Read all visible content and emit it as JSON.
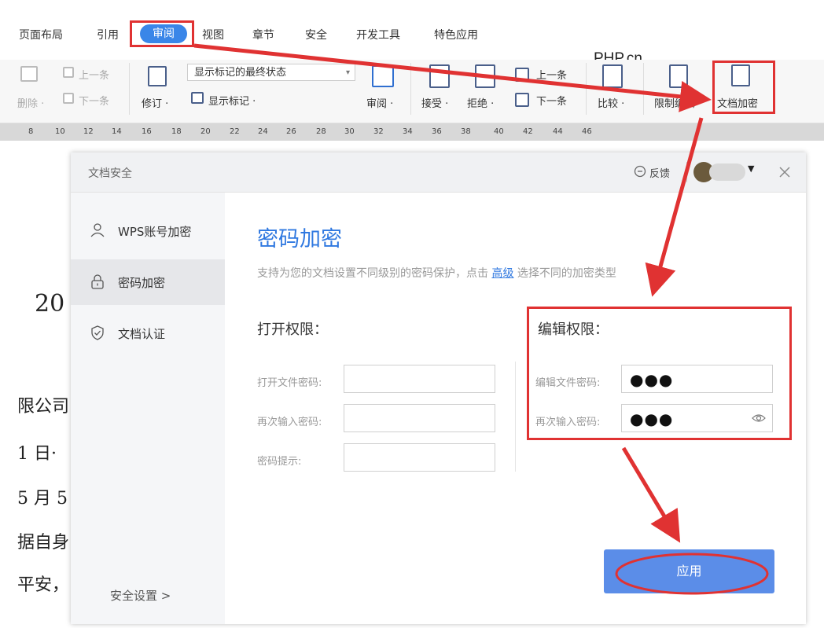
{
  "menu": {
    "items": [
      "页面布局",
      "引用",
      "审阅",
      "视图",
      "章节",
      "安全",
      "开发工具",
      "特色应用"
    ],
    "active_index": 2
  },
  "watermark": "PHP.cn",
  "ribbon": {
    "prev_label": "上一条",
    "next_label": "下一条",
    "delete_label": "删除 ·",
    "revise_label": "修订 ·",
    "markup_state_value": "显示标记的最终状态",
    "show_markup_label": "显示标记 ·",
    "review_label": "审阅 ·",
    "accept_label": "接受 ·",
    "reject_label": "拒绝 ·",
    "prev2_label": "上一条",
    "next2_label": "下一条",
    "compare_label": "比较 ·",
    "restrict_label": "限制编辑",
    "encrypt_label": "文档加密"
  },
  "ruler": [
    "8",
    "10",
    "12",
    "14",
    "16",
    "18",
    "20",
    "22",
    "24",
    "26",
    "28",
    "30",
    "32",
    "34",
    "36",
    "38",
    "40",
    "42",
    "44",
    "46"
  ],
  "document": {
    "fragments": [
      "20",
      "限公司",
      "1 日·",
      "5 月 5",
      "据自身",
      "平安，"
    ]
  },
  "dialog": {
    "title": "文档安全",
    "feedback": "反馈",
    "sidebar": {
      "items": [
        "WPS账号加密",
        "密码加密",
        "文档认证"
      ],
      "active_index": 1,
      "settings": "安全设置 >"
    },
    "heading": "密码加密",
    "desc_before": "支持为您的文档设置不同级别的密码保护，点击 ",
    "desc_link": "高级",
    "desc_after": " 选择不同的加密类型",
    "open_section": {
      "title": "打开权限：",
      "fields": [
        "打开文件密码:",
        "再次输入密码:",
        "密码提示:"
      ]
    },
    "edit_section": {
      "title": "编辑权限：",
      "fields": [
        "编辑文件密码:",
        "再次输入密码:"
      ],
      "values": [
        "●●●",
        "●●●"
      ]
    },
    "apply_label": "应用"
  },
  "colors": {
    "accent": "#3a86e8",
    "annotation_red": "#e03232",
    "apply_button": "#5b8de8"
  }
}
